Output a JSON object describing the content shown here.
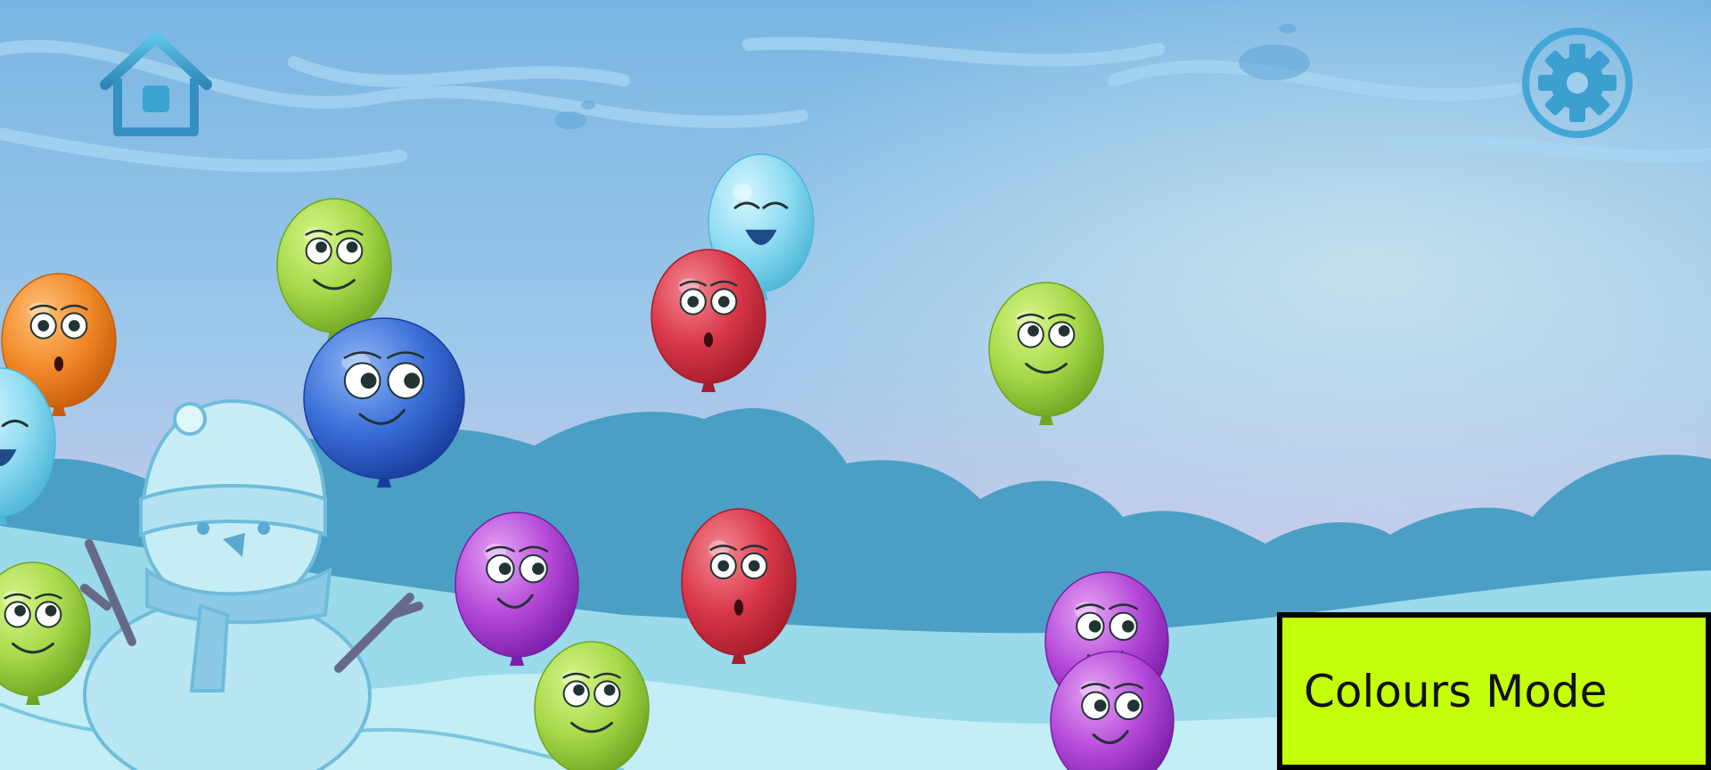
{
  "game": {
    "mode_label": "Colours Mode",
    "mode_banner_color": "#c4ff0a"
  },
  "hud": {
    "home_icon": "home-icon",
    "settings_icon": "gear-icon"
  },
  "scene": {
    "theme": "winter",
    "decorations": [
      "snowman",
      "snow-hills",
      "sky-swirls"
    ]
  },
  "palette": {
    "green": {
      "light": "#d9f58a",
      "mid": "#a6d94a",
      "dark": "#6fa521"
    },
    "orange": {
      "light": "#ffc27a",
      "mid": "#f28a2a",
      "dark": "#c85e0c"
    },
    "blue": {
      "light": "#8fb7f5",
      "mid": "#3a6fd8",
      "dark": "#1a3c9e"
    },
    "cyan": {
      "light": "#d6f6ff",
      "mid": "#8fdcf2",
      "dark": "#4eb7d8"
    },
    "red": {
      "light": "#f58a94",
      "mid": "#d9384a",
      "dark": "#a51c2c"
    },
    "purple": {
      "light": "#e6a6f5",
      "mid": "#b54ad9",
      "dark": "#7a1ea8"
    }
  },
  "balloons": [
    {
      "color": "green",
      "expression": "looking-up"
    },
    {
      "color": "orange",
      "expression": "surprised"
    },
    {
      "color": "blue",
      "expression": "smirk"
    },
    {
      "color": "cyan",
      "expression": "happy"
    },
    {
      "color": "red",
      "expression": "surprised"
    },
    {
      "color": "green",
      "expression": "looking-up"
    },
    {
      "color": "cyan",
      "expression": "happy"
    },
    {
      "color": "green",
      "expression": "looking-up"
    },
    {
      "color": "purple",
      "expression": "smirk"
    },
    {
      "color": "red",
      "expression": "surprised"
    },
    {
      "color": "green",
      "expression": "looking-up"
    },
    {
      "color": "purple",
      "expression": "smirk"
    },
    {
      "color": "purple",
      "expression": "smirk"
    }
  ]
}
